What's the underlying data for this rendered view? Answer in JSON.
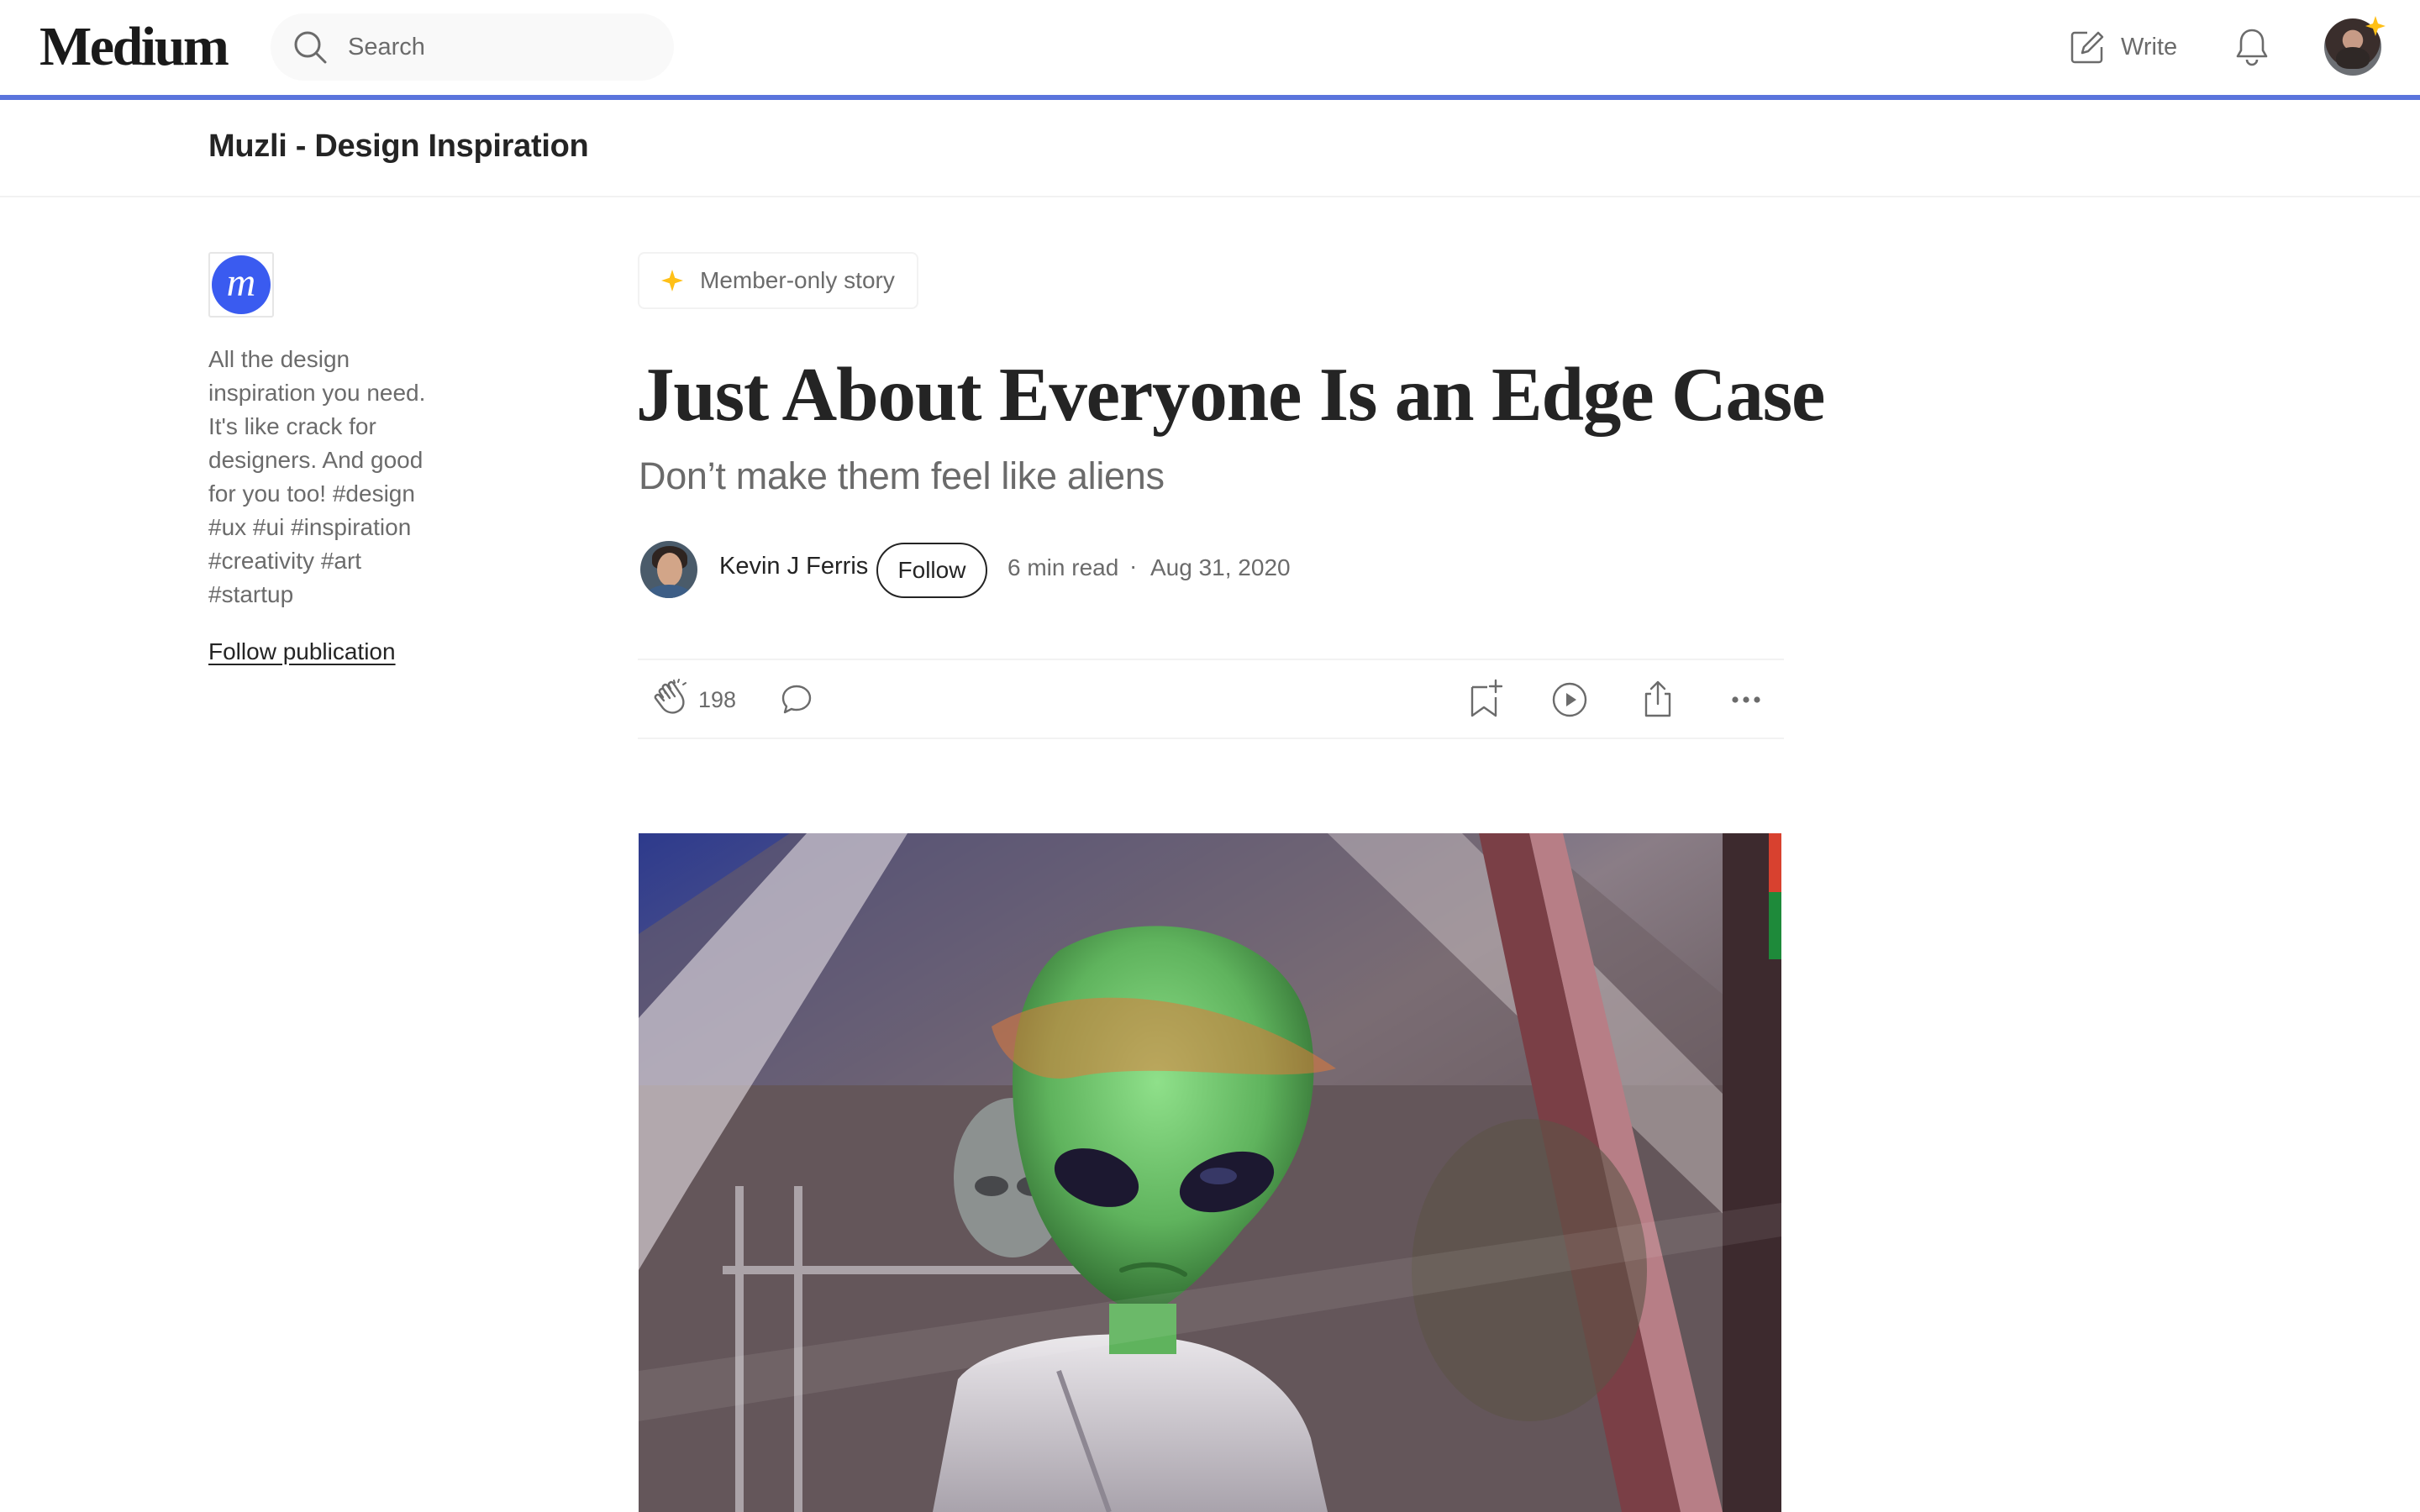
{
  "app": {
    "logo": "Medium",
    "search": {
      "placeholder": "Search"
    },
    "write_label": "Write"
  },
  "publication": {
    "name": "Muzli - Design Inspiration",
    "logo_letter": "m",
    "description": "All the design inspiration you need. It's like crack for designers. And good for you too! #design #ux #ui #inspiration #creativity #art #startup",
    "follow_label": "Follow publication"
  },
  "article": {
    "badge": "Member-only story",
    "title": "Just About Everyone Is an Edge Case",
    "subtitle": "Don’t make them feel like aliens",
    "author": "Kevin J Ferris",
    "follow_label": "Follow",
    "read_time": "6 min read",
    "separator": "·",
    "date": "Aug 31, 2020",
    "claps": "198"
  },
  "icons": {
    "search": "search-icon",
    "write": "write-icon",
    "bell": "bell-icon",
    "star": "member-star-icon",
    "clap": "clap-icon",
    "response": "response-icon",
    "save": "bookmark-add-icon",
    "listen": "play-icon",
    "share": "share-icon",
    "more": "more-icon"
  },
  "colors": {
    "accent_rule": "#5a74dc",
    "publication_logo": "#3a5bf0",
    "member_star": "#ffc017",
    "text_primary": "#242424",
    "text_secondary": "#6b6b6b"
  }
}
